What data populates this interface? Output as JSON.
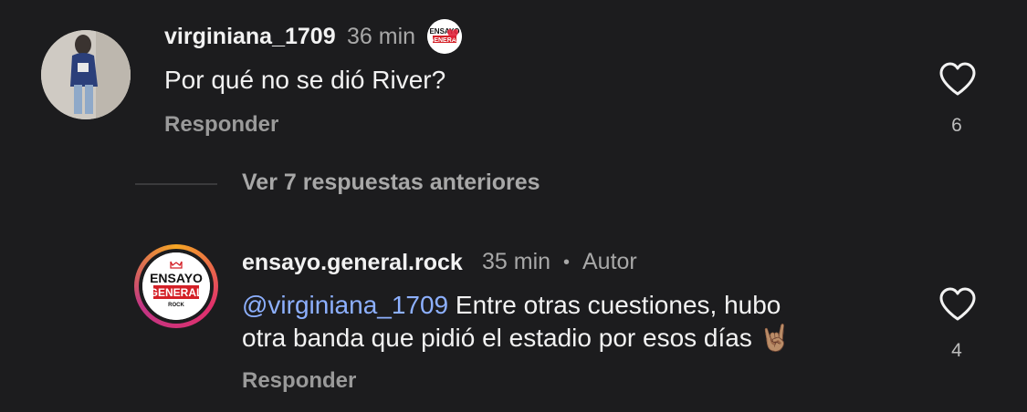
{
  "comments": [
    {
      "username": "virginiana_1709",
      "time": "36 min",
      "text": "Por qué no se dió River?",
      "reply_label": "Responder",
      "likes": "6"
    }
  ],
  "replies_toggle": {
    "label": "Ver 7 respuestas anteriores"
  },
  "reply": {
    "username": "ensayo.general.rock",
    "time": "35 min",
    "separator": "•",
    "role": "Autor",
    "mention": "@virginiana_1709",
    "text_line1": " Entre otras cuestiones, hubo",
    "text_line2": "otra banda que pidió el estadio por esos días",
    "emoji": "🤘🏽",
    "reply_label": "Responder",
    "likes": "4"
  },
  "logo": {
    "line1": "ENSAYO",
    "line2": "GENERAL",
    "line3": "ROCK",
    "red": "#d42027"
  },
  "colors": {
    "background": "#1c1c1e",
    "mention": "#8db0ff",
    "muted": "#a8a8a8"
  }
}
